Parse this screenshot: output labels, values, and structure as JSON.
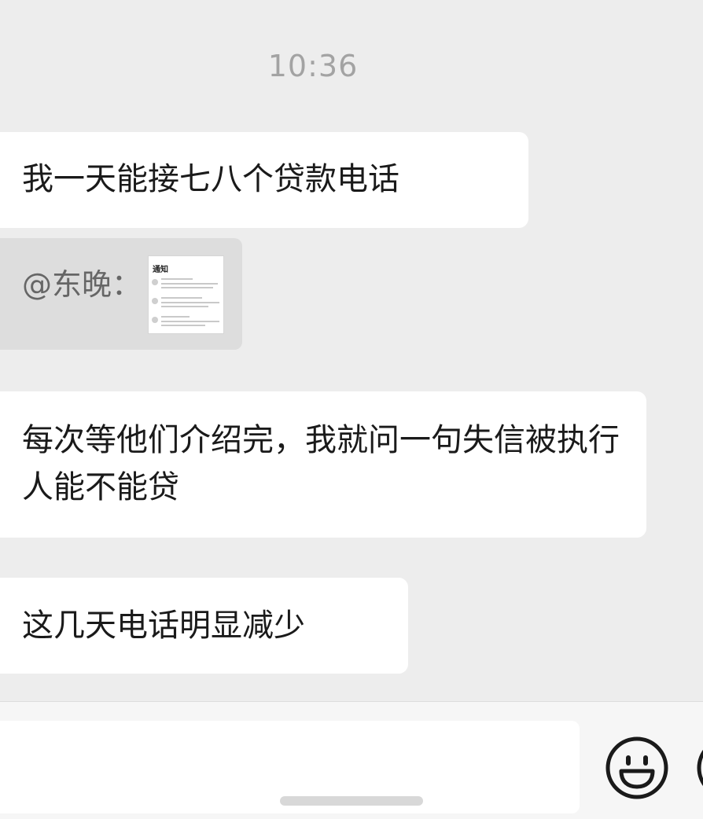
{
  "chat": {
    "timestamp": "10:36",
    "messages": [
      {
        "text": "我一天能接七八个贷款电话"
      },
      {
        "quote_author": "@东晚：",
        "thumb_title": "通知"
      },
      {
        "text": "每次等他们介绍完，我就问一句失信被执行人能不能贷"
      },
      {
        "text": "这几天电话明显减少"
      }
    ]
  },
  "input_bar": {
    "message_value": "",
    "icons": [
      "emoji-icon",
      "plus-icon"
    ]
  },
  "colors": {
    "background": "#ededed",
    "bubble": "#ffffff",
    "quote": "#dddddd",
    "timestamp": "#a3a3a3"
  }
}
